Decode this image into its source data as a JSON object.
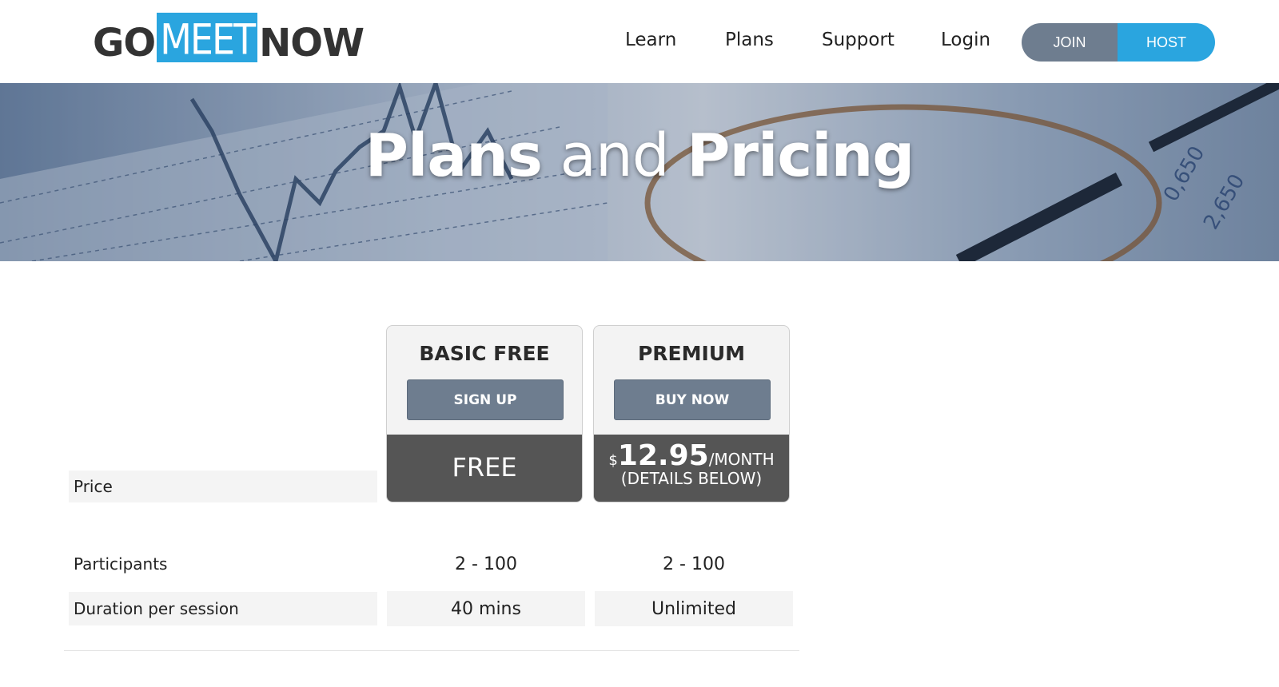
{
  "header": {
    "logo": {
      "part1": "GO",
      "part2": "MEET",
      "part3": "NOW"
    },
    "nav": [
      {
        "label": "Learn"
      },
      {
        "label": "Plans"
      },
      {
        "label": "Support"
      },
      {
        "label": "Login"
      }
    ],
    "join_label": "JOIN",
    "host_label": "HOST"
  },
  "hero": {
    "title_bold1": "Plans",
    "title_light": "and",
    "title_bold2": "Pricing"
  },
  "plans": [
    {
      "name": "BASIC FREE",
      "cta": "SIGN UP",
      "price": "FREE"
    },
    {
      "name": "PREMIUM",
      "cta": "BUY NOW",
      "price_currency": "$",
      "price_amount": "12.95",
      "price_period": "/MONTH",
      "price_details": "(DETAILS BELOW)"
    }
  ],
  "rows": [
    {
      "label": "Price"
    },
    {
      "label": "Participants",
      "values": [
        "2 - 100",
        "2 - 100"
      ]
    },
    {
      "label": "Duration per session",
      "values": [
        "40 mins",
        "Unlimited"
      ]
    }
  ],
  "colors": {
    "accent": "#2aa5df",
    "button_gray": "#6e7d8f",
    "price_band": "#555555"
  }
}
